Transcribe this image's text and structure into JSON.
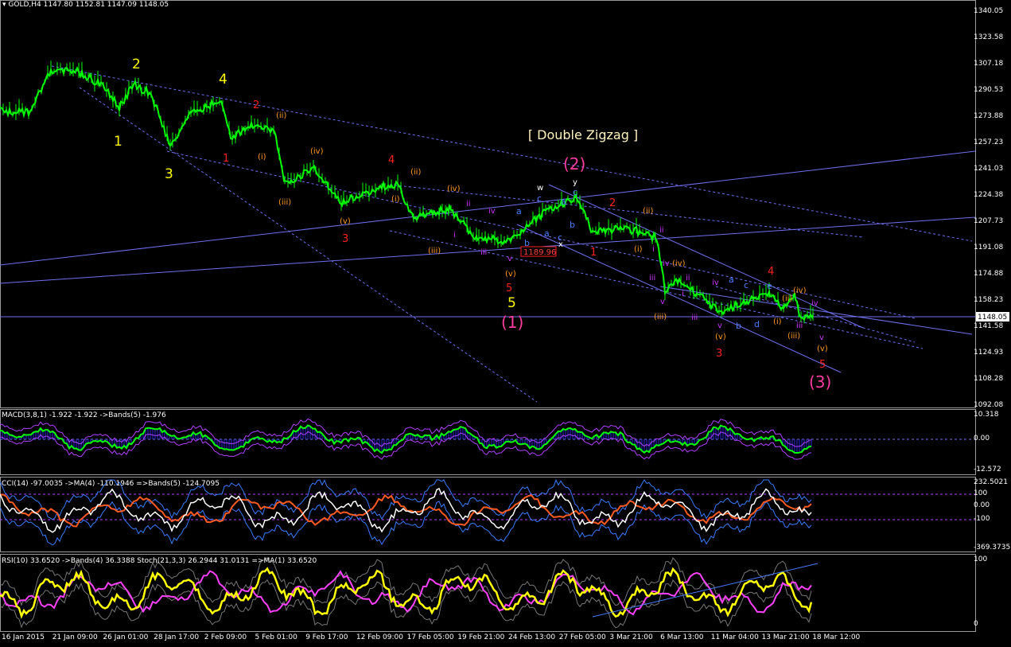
{
  "header": {
    "symbol_line": "GOLD,H4  1147.80 1152.81 1147.09 1148.05"
  },
  "colors": {
    "background": "#000000",
    "candle": "#00ff00",
    "trendline": "#6f6ff0",
    "yellow": "#ffff00",
    "red": "#ff2020",
    "magenta": "#ff3c9f",
    "orange": "#ff9a20",
    "blue": "#4a7cff",
    "violet": "#cc33ff"
  },
  "price_axis": {
    "ticks": [
      "1340.05",
      "1323.58",
      "1307.18",
      "1290.53",
      "1273.88",
      "1257.23",
      "1241.03",
      "1224.38",
      "1207.73",
      "1191.08",
      "1174.88",
      "1158.23",
      "1141.58",
      "1124.93",
      "1108.28",
      "1092.08"
    ],
    "current_price": "1148.05"
  },
  "time_axis": {
    "ticks": [
      "16 Jan 2015",
      "21 Jan 09:00",
      "26 Jan 01:00",
      "28 Jan 17:00",
      "2 Feb 09:00",
      "5 Feb 01:00",
      "9 Feb 17:00",
      "12 Feb 09:00",
      "17 Feb 05:00",
      "19 Feb 21:00",
      "24 Feb 13:00",
      "27 Feb 05:00",
      "3 Mar 21:00",
      "6 Mar 13:00",
      "11 Mar 04:00",
      "13 Mar 21:00",
      "18 Mar 12:00"
    ]
  },
  "annotations": {
    "title": "[ Double Zigzag ]",
    "price_box": "1189.96",
    "yellow_labels": [
      "2",
      "4",
      "1",
      "3",
      "5"
    ],
    "magenta_labels": [
      "(2)",
      "(1)",
      "(3)"
    ]
  },
  "macd": {
    "label": "MACD(3,8,1) -1.922 -1.922  ->Bands(5) -1.976",
    "ticks": [
      "10.318",
      "0.00",
      "-12.572"
    ]
  },
  "cci": {
    "label": "CCI(14) -97.0035  ->MA(4) -110.1946  =>Bands(5) -124.7095",
    "ticks": [
      "232.5021",
      "100",
      "0.00",
      "-100",
      "-369.3735"
    ]
  },
  "rsi": {
    "label": "RSI(10) 33.6520  ->Bands(4) 36.3388  Stoch(21,3,3) 26.2944 31.0131  =>MA(1) 33.6520",
    "ticks": [
      "100",
      "0"
    ]
  }
}
